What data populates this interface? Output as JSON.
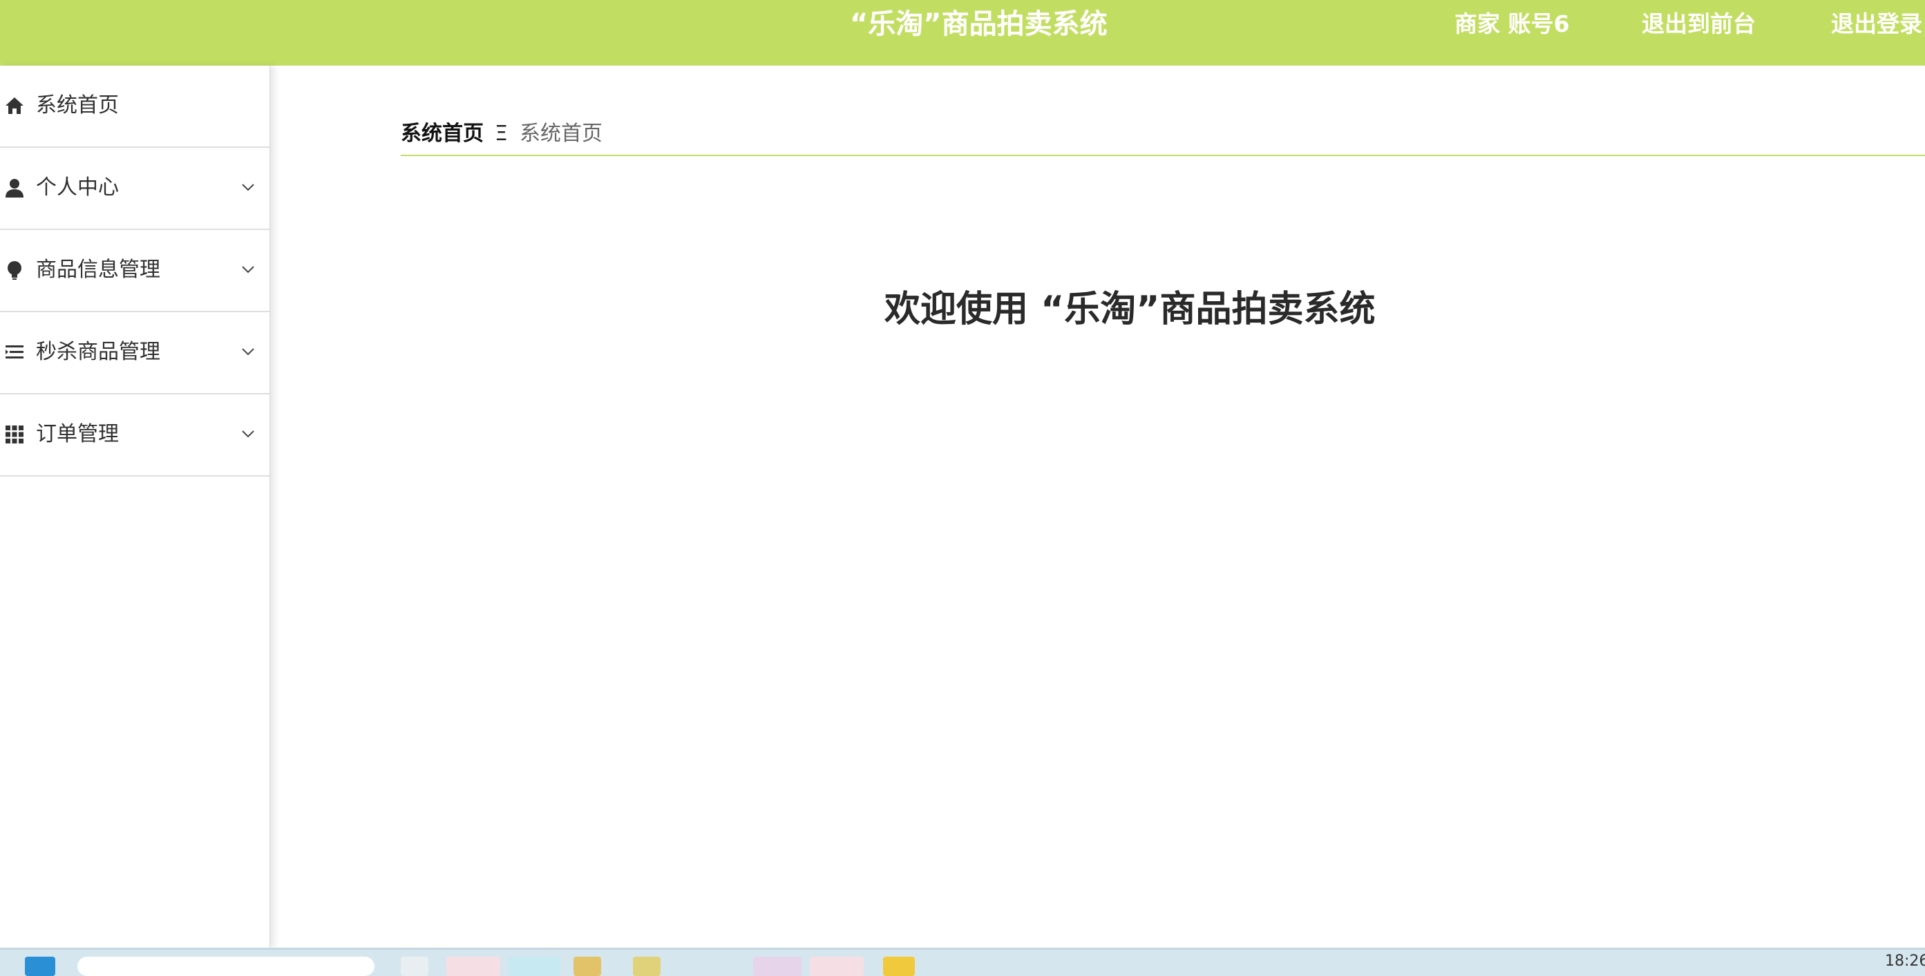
{
  "header": {
    "title": "“乐淘”商品拍卖系统",
    "user": "商家 账号6",
    "back_to_front": "退出到前台",
    "logout": "退出登录"
  },
  "sidebar": {
    "items": [
      {
        "label": "系统首页",
        "icon": "home-icon",
        "has_submenu": false
      },
      {
        "label": "个人中心",
        "icon": "user-icon",
        "has_submenu": true
      },
      {
        "label": "商品信息管理",
        "icon": "lightbulb-icon",
        "has_submenu": true
      },
      {
        "label": "秒杀商品管理",
        "icon": "list-indent-icon",
        "has_submenu": true
      },
      {
        "label": "订单管理",
        "icon": "grid-icon",
        "has_submenu": true
      }
    ]
  },
  "breadcrumb": {
    "root": "系统首页",
    "separator": "Ξ",
    "current": "系统首页"
  },
  "main": {
    "welcome": "欢迎使用 “乐淘”商品拍卖系统"
  },
  "taskbar": {
    "clock": "18:26"
  },
  "colors": {
    "accent": "#c2de62",
    "text": "#303030",
    "taskbar": "#d6e6ee"
  }
}
